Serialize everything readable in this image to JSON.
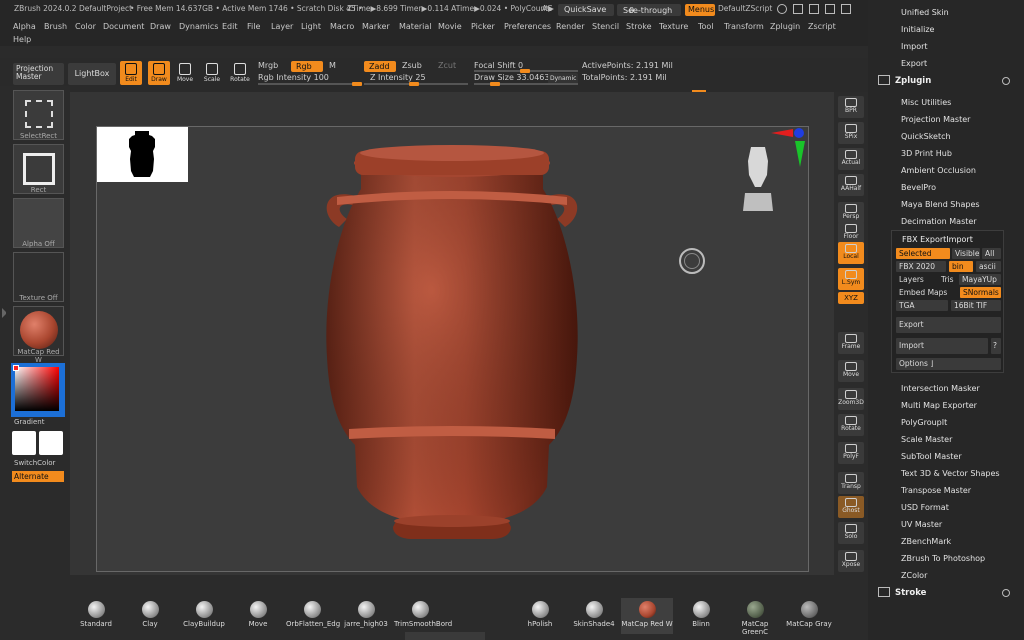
{
  "title_bar": {
    "app": "ZBrush 2024.0.2 DefaultProject",
    "mem": "• Free Mem 14.637GB • Active Mem 1746 • Scratch Disk 45 •",
    "timers": "ZTime▶8.699 Timer▶0.114 ATime▶0.024 • PolyCount▶",
    "ac": "AC",
    "quicksave": "QuickSave",
    "see_through": "See-through",
    "see_through_value": "0",
    "menus": "Menus",
    "script": "DefaultZScript"
  },
  "menu_bar": [
    "Alpha",
    "Brush",
    "Color",
    "Document",
    "Draw",
    "Dynamics",
    "Edit",
    "File",
    "Layer",
    "Light",
    "Macro",
    "Marker",
    "Material",
    "Movie",
    "Picker",
    "Preferences",
    "Render",
    "Stencil",
    "Stroke",
    "Texture",
    "Tool",
    "Transform",
    "Zplugin",
    "Zscript",
    "Help"
  ],
  "toolbar": {
    "projection_master": "Projection Master",
    "lightbox": "LightBox",
    "edit": "Edit",
    "draw": "Draw",
    "move": "Move",
    "scale": "Scale",
    "rotate": "Rotate",
    "mrgb": "Mrgb",
    "rgb": "Rgb",
    "m": "M",
    "rgb_intensity": "Rgb Intensity 100",
    "zadd": "Zadd",
    "zsub": "Zsub",
    "zcut": "Zcut",
    "z_intensity": "Z Intensity 25",
    "focal_shift": "Focal Shift 0",
    "draw_size": "Draw Size 33.04633",
    "dynamic": "Dynamic",
    "active_points": "ActivePoints: 2.191 Mil",
    "total_points": "TotalPoints: 2.191 Mil"
  },
  "left_shelf": {
    "select_rect": "SelectRect",
    "rect": "Rect",
    "alpha_off": "Alpha Off",
    "texture_off": "Texture Off",
    "material": "MatCap Red W",
    "gradient": "Gradient",
    "switch_color": "SwitchColor",
    "alternate": "Alternate"
  },
  "right_shelf": [
    "BPR",
    "SPix",
    "Actual",
    "AAHalf",
    "Persp",
    "Floor",
    "Local",
    "L.Sym",
    "Frame",
    "Move",
    "Zoom3D",
    "Rotate",
    "PolyF",
    "Transp",
    "Ghost",
    "Solo",
    "Xpose"
  ],
  "right_shelf_xyz": "XYZ",
  "bottom_brushes": [
    "Standard",
    "Clay",
    "ClayBuildup",
    "Move",
    "OrbFlatten_Edg",
    "jarre_high03",
    "TrimSmoothBord"
  ],
  "bottom_materials": [
    "hPolish",
    "SkinShade4",
    "MatCap Red W",
    "Blinn",
    "MatCap GreenC",
    "MatCap Gray"
  ],
  "tray": {
    "top_items": [
      "Unified Skin",
      "Initialize",
      "Import",
      "Export"
    ],
    "zplugin": "Zplugin",
    "zplugin_items": [
      "Misc Utilities",
      "Projection Master",
      "QuickSketch",
      "3D Print Hub",
      "Ambient Occlusion",
      "BevelPro",
      "Maya Blend Shapes",
      "Decimation Master"
    ],
    "fbx": {
      "title": "FBX ExportImport",
      "selected": "Selected",
      "visible": "Visible",
      "all": "All",
      "version": "FBX 2020",
      "bin": "bin",
      "ascii": "ascii",
      "layers": "Layers",
      "tris": "Tris",
      "mayayup": "MayaYUp",
      "embed_maps": "Embed Maps",
      "snormals": "SNormals",
      "tga": "TGA",
      "tif": "16Bit TIF",
      "export": "Export",
      "import": "Import",
      "help": "?",
      "options": "Options ⌋"
    },
    "after_items": [
      "Intersection Masker",
      "Multi Map Exporter",
      "PolyGroupIt",
      "Scale Master",
      "SubTool Master",
      "Text 3D & Vector Shapes",
      "Transpose Master",
      "USD Format",
      "UV Master",
      "ZBenchMark",
      "ZBrush To Photoshop",
      "ZColor"
    ],
    "stroke": "Stroke"
  },
  "colors": {
    "accent": "#f28b1d",
    "vase": "#a9462f",
    "background": "#2b2b2b"
  }
}
